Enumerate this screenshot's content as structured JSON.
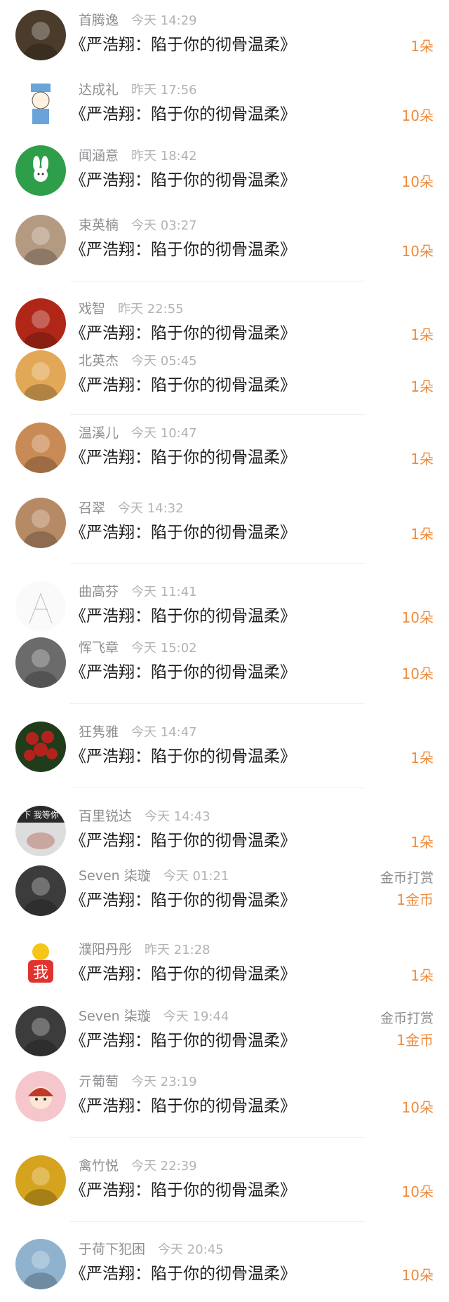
{
  "dividers": [
    400,
    590,
    802,
    1002,
    1122,
    1620,
    1740
  ],
  "items": [
    {
      "name": "首腾逸",
      "time": "今天 14:29",
      "title": "《严浩翔：陷于你的彻骨温柔》",
      "gift": "1朵",
      "avatar": "dark-photo-avatar",
      "avatarColor": "#4a3b2a"
    },
    {
      "name": "达成礼",
      "time": "昨天 17:56",
      "title": "《严浩翔：陷于你的彻骨温柔》",
      "gift": "10朵",
      "avatar": "cartoon-avatar",
      "avatarColor": "#6aa3d8"
    },
    {
      "name": "闻涵意",
      "time": "昨天 18:42",
      "title": "《严浩翔：陷于你的彻骨温柔》",
      "gift": "10朵",
      "avatar": "green-bunny-avatar",
      "avatarColor": "#2e9e4a"
    },
    {
      "name": "束英楠",
      "time": "今天 03:27",
      "title": "《严浩翔：陷于你的彻骨温柔》",
      "gift": "10朵",
      "avatar": "painting-avatar",
      "avatarColor": "#b59a82"
    },
    {
      "name": "戏智",
      "time": "昨天 22:55",
      "title": "《严浩翔：陷于你的彻骨温柔》",
      "gift": "1朵",
      "avatar": "red-warrior-avatar",
      "avatarColor": "#b02718"
    },
    {
      "name": "北英杰",
      "time": "今天 05:45",
      "title": "《严浩翔：陷于你的彻骨温柔》",
      "gift": "1朵",
      "avatar": "food-avatar",
      "avatarColor": "#e3a857"
    },
    {
      "name": "温溪儿",
      "time": "今天 10:47",
      "title": "《严浩翔：陷于你的彻骨温柔》",
      "gift": "1朵",
      "avatar": "alpaca-avatar",
      "avatarColor": "#c98b55"
    },
    {
      "name": "召翠",
      "time": "今天 14:32",
      "title": "《严浩翔：陷于你的彻骨温柔》",
      "gift": "1朵",
      "avatar": "woman-photo-avatar",
      "avatarColor": "#b78a66"
    },
    {
      "name": "曲高芬",
      "time": "今天 11:41",
      "title": "《严浩翔：陷于你的彻骨温柔》",
      "gift": "10朵",
      "avatar": "sketch-avatar",
      "avatarColor": "#e9e9e9"
    },
    {
      "name": "恽飞章",
      "time": "今天 15:02",
      "title": "《严浩翔：陷于你的彻骨温柔》",
      "gift": "10朵",
      "avatar": "anime-avatar",
      "avatarColor": "#6b6b6b"
    },
    {
      "name": "狂隽雅",
      "time": "今天 14:47",
      "title": "《严浩翔：陷于你的彻骨温柔》",
      "gift": "1朵",
      "avatar": "roses-avatar",
      "avatarColor": "#b3231d"
    },
    {
      "name": "百里锐达",
      "time": "今天 14:43",
      "title": "《严浩翔：陷于你的彻骨温柔》",
      "gift": "1朵",
      "avatar": "text-photo-avatar",
      "avatarColor": "#2a2a2a",
      "avatarText": "下 我等你"
    },
    {
      "name": "Seven 柒璇",
      "time": "今天 01:21",
      "title": "《严浩翔：陷于你的彻骨温柔》",
      "giftLabel": "金币打赏",
      "gift": "1金币",
      "avatar": "bw-photo-avatar",
      "avatarColor": "#3c3c3c"
    },
    {
      "name": "濮阳丹彤",
      "time": "昨天 21:28",
      "title": "《严浩翔：陷于你的彻骨温柔》",
      "gift": "1朵",
      "avatar": "wo-sticker-avatar",
      "avatarColor": "#ffffff",
      "avatarText": "我"
    },
    {
      "name": "Seven 柒璇",
      "time": "今天 19:44",
      "title": "《严浩翔：陷于你的彻骨温柔》",
      "giftLabel": "金币打赏",
      "gift": "1金币",
      "avatar": "bw-photo-avatar",
      "avatarColor": "#3c3c3c"
    },
    {
      "name": "亓葡萄",
      "time": "今天 23:19",
      "title": "《严浩翔：陷于你的彻骨温柔》",
      "gift": "10朵",
      "avatar": "cartoon-girl-avatar",
      "avatarColor": "#f5c6cc"
    },
    {
      "name": "禽竹悦",
      "time": "今天 22:39",
      "title": "《严浩翔：陷于你的彻骨温柔》",
      "gift": "10朵",
      "avatar": "selfie-avatar",
      "avatarColor": "#d6a31f"
    },
    {
      "name": "于荷下犯困",
      "time": "今天 20:45",
      "title": "《严浩翔：陷于你的彻骨温柔》",
      "gift": "10朵",
      "avatar": "glasses-anime-avatar",
      "avatarColor": "#8fb3cf"
    }
  ]
}
